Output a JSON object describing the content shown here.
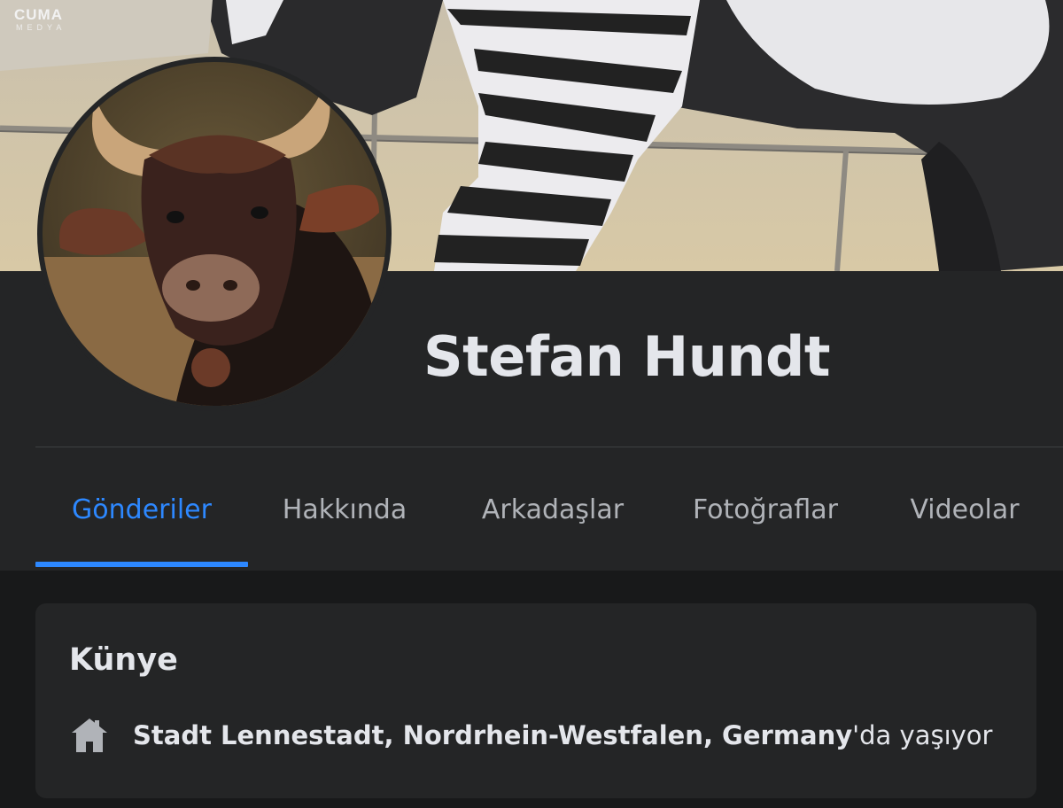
{
  "watermark": {
    "line1": "CUMA",
    "line2": "MEDYA"
  },
  "profile": {
    "name": "Stefan Hundt",
    "avatar_subject": "bull-photo",
    "cover_subject": "painted-zebra-cow-mural"
  },
  "tabs": [
    {
      "label": "Gönderiler",
      "active": true
    },
    {
      "label": "Hakkında",
      "active": false
    },
    {
      "label": "Arkadaşlar",
      "active": false
    },
    {
      "label": "Fotoğraflar",
      "active": false
    },
    {
      "label": "Videolar",
      "active": false
    }
  ],
  "intro": {
    "title": "Künye",
    "location_icon": "home-icon",
    "location": "Stadt Lennestadt, Nordrhein-Westfalen, Germany",
    "location_suffix": "'da yaşıyor"
  },
  "colors": {
    "background": "#18191a",
    "panel": "#242526",
    "accent": "#2d88ff",
    "text_primary": "#e4e6eb",
    "text_secondary": "#b0b3b8"
  }
}
